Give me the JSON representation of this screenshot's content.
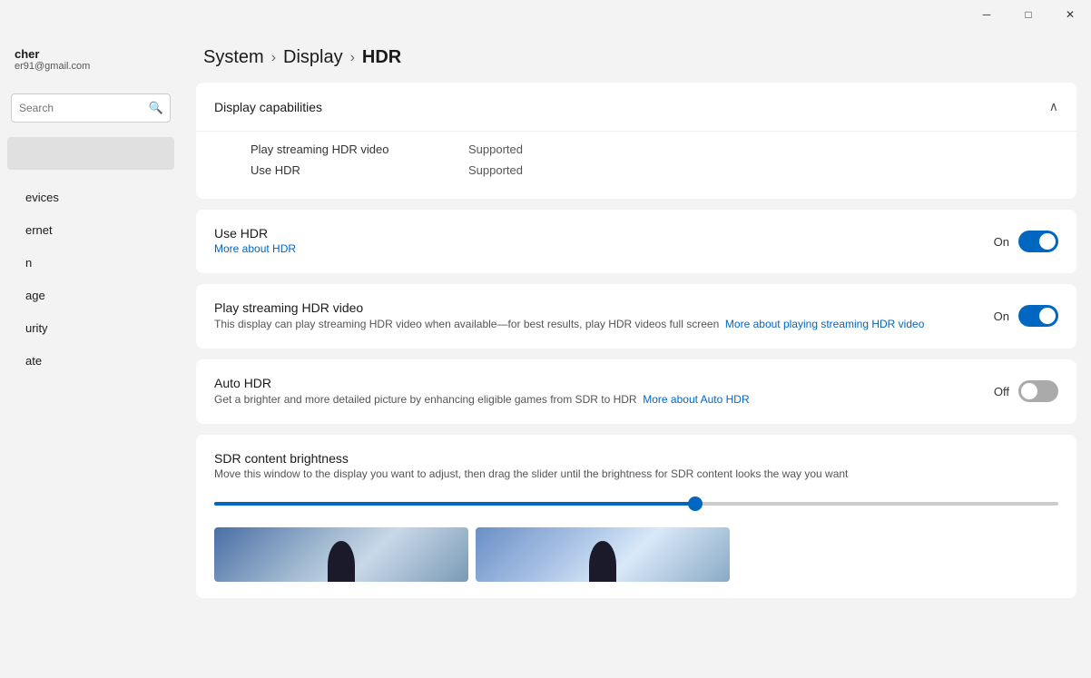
{
  "titlebar": {
    "minimize": "─",
    "maximize": "□",
    "close": "✕"
  },
  "sidebar": {
    "user_name": "cher",
    "user_email": "er91@gmail.com",
    "search_placeholder": "Search",
    "nav_items": [
      {
        "id": "devices",
        "label": "evices"
      },
      {
        "id": "internet",
        "label": "ernet"
      },
      {
        "id": "network",
        "label": "n"
      },
      {
        "id": "storage",
        "label": "age"
      },
      {
        "id": "security",
        "label": "urity"
      },
      {
        "id": "update",
        "label": "ate"
      }
    ]
  },
  "breadcrumb": {
    "part1": "System",
    "sep1": "›",
    "part2": "Display",
    "sep2": "›",
    "part3": "HDR"
  },
  "capabilities": {
    "header": "Display capabilities",
    "rows": [
      {
        "label": "Play streaming HDR video",
        "value": "Supported"
      },
      {
        "label": "Use HDR",
        "value": "Supported"
      }
    ]
  },
  "settings": {
    "use_hdr": {
      "title": "Use HDR",
      "link": "More about HDR",
      "state": "On",
      "enabled": true
    },
    "play_streaming": {
      "title": "Play streaming HDR video",
      "desc_prefix": "This display can play streaming HDR video when available—for best results, play HDR videos full screen",
      "link": "More about playing streaming HDR video",
      "state": "On",
      "enabled": true
    },
    "auto_hdr": {
      "title": "Auto HDR",
      "desc_prefix": "Get a brighter and more detailed picture by enhancing eligible games from SDR to HDR",
      "link": "More about Auto HDR",
      "state": "Off",
      "enabled": false
    }
  },
  "brightness": {
    "title": "SDR content brightness",
    "desc": "Move this window to the display you want to adjust, then drag the slider until the brightness for SDR content looks the way you want"
  }
}
